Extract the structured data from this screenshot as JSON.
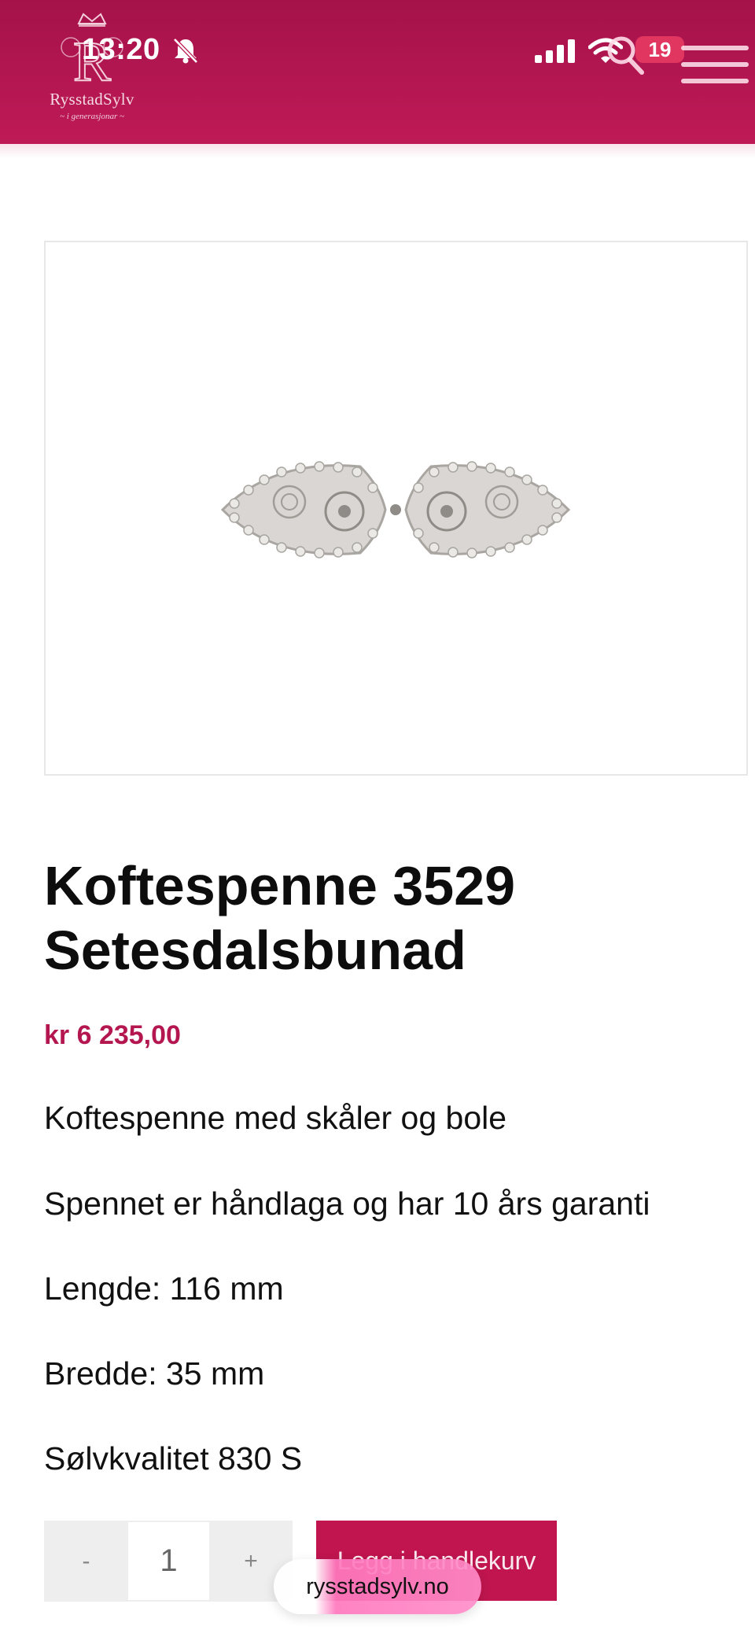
{
  "status_bar": {
    "time": "13:20",
    "notification_count": "19"
  },
  "header": {
    "brand_name": "RysstadSylv",
    "brand_tagline": "~ i generasjonar ~",
    "accent_color": "#b4174f"
  },
  "icons": {
    "bell": "bell-muted-icon",
    "signal": "signal-icon",
    "wifi": "wifi-icon",
    "search": "search-icon",
    "menu": "hamburger-menu-icon"
  },
  "product": {
    "title": "Koftespenne 3529 Setesdalsbunad",
    "price": "kr 6 235,00",
    "description": [
      "Koftespenne med skåler og bole",
      "Spennet er håndlaga og har 10 års garanti",
      "Lengde: 116 mm",
      "Bredde: 35 mm",
      "Sølvkvalitet 830 S"
    ]
  },
  "cart": {
    "minus_label": "-",
    "quantity": "1",
    "plus_label": "+",
    "add_button_label": "Legg i handlekurv"
  },
  "browser": {
    "url": "rysstadsylv.no"
  }
}
